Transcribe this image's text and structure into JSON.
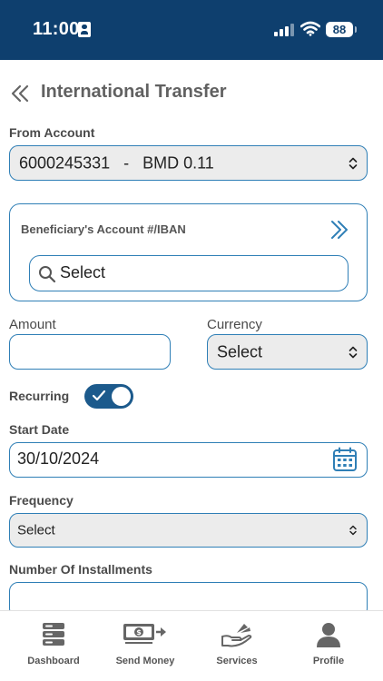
{
  "status_bar": {
    "time": "11:00",
    "battery": "88"
  },
  "header": {
    "title": "International Transfer"
  },
  "from_account": {
    "label": "From Account",
    "value": "6000245331   -   BMD 0.11"
  },
  "beneficiary": {
    "label": "Beneficiary's Account #/IBAN",
    "placeholder": "Select"
  },
  "amount": {
    "label": "Amount",
    "value": ""
  },
  "currency": {
    "label": "Currency",
    "value": "Select"
  },
  "recurring": {
    "label": "Recurring",
    "enabled": true
  },
  "start_date": {
    "label": "Start Date",
    "value": "30/10/2024"
  },
  "frequency": {
    "label": "Frequency",
    "value": "Select"
  },
  "installments": {
    "label": "Number Of Installments",
    "value": ""
  },
  "bottom_nav": {
    "items": [
      {
        "label": "Dashboard",
        "icon": "dashboard-icon"
      },
      {
        "label": "Send Money",
        "icon": "send-money-icon"
      },
      {
        "label": "Services",
        "icon": "services-icon"
      },
      {
        "label": "Profile",
        "icon": "profile-icon"
      }
    ]
  },
  "colors": {
    "primary": "#0e3f6e",
    "accent": "#2f7fb6",
    "toggle": "#1c5a8c"
  }
}
